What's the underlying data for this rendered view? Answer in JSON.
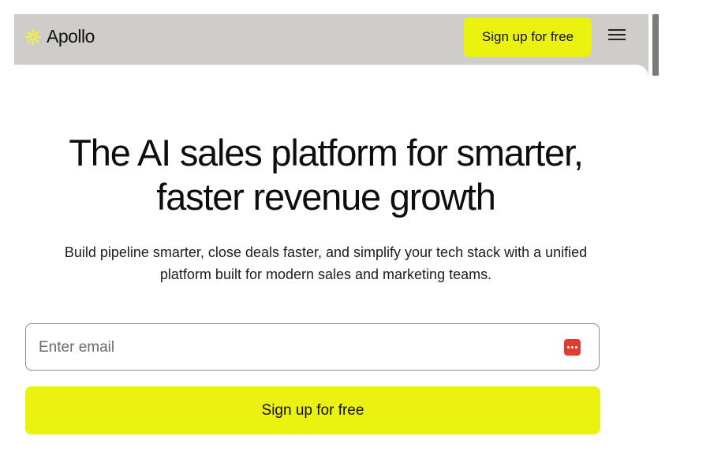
{
  "header": {
    "logo_text": "Apollo",
    "cta_label": "Sign up for free",
    "menu_icon": "hamburger-menu-icon"
  },
  "hero": {
    "title_line1": "The AI sales platform for smarter,",
    "title_line2": "faster revenue growth",
    "subtitle_line1": "Build pipeline smarter, close deals faster, and simplify your tech stack with a unified",
    "subtitle_line2": "platform built for modern sales and marketing teams."
  },
  "signup_form": {
    "email_placeholder": "Enter email",
    "email_value": "",
    "submit_label": "Sign up for free"
  },
  "colors": {
    "accent": "#ebf20f",
    "navbar_bg": "#cfcdc9",
    "logo_mark": "#f3f045",
    "password_manager": "#e23b34"
  }
}
